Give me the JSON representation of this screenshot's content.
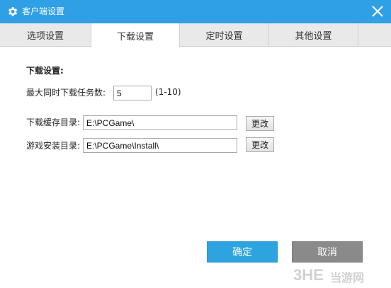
{
  "window": {
    "title": "客户端设置",
    "accent_color": "#2f9fe6"
  },
  "tabs": [
    {
      "label": "选项设置",
      "active": false
    },
    {
      "label": "下载设置",
      "active": true
    },
    {
      "label": "定时设置",
      "active": false
    },
    {
      "label": "其他设置",
      "active": false
    }
  ],
  "download": {
    "section_title": "下载设置:",
    "max_tasks_label": "最大同时下载任务数:",
    "max_tasks_value": "5",
    "max_tasks_range": "(1-10)",
    "cache_dir_label": "下载缓存目录:",
    "cache_dir_value": "E:\\PCGame\\",
    "cache_change_label": "更改",
    "install_dir_label": "游戏安装目录:",
    "install_dir_value": "E:\\PCGame\\Install\\",
    "install_change_label": "更改"
  },
  "footer": {
    "ok_label": "确定",
    "cancel_label": "取消",
    "ok_color": "#2da3e0",
    "cancel_color": "#8a8a8a"
  },
  "watermark": {
    "text": "当游网"
  }
}
